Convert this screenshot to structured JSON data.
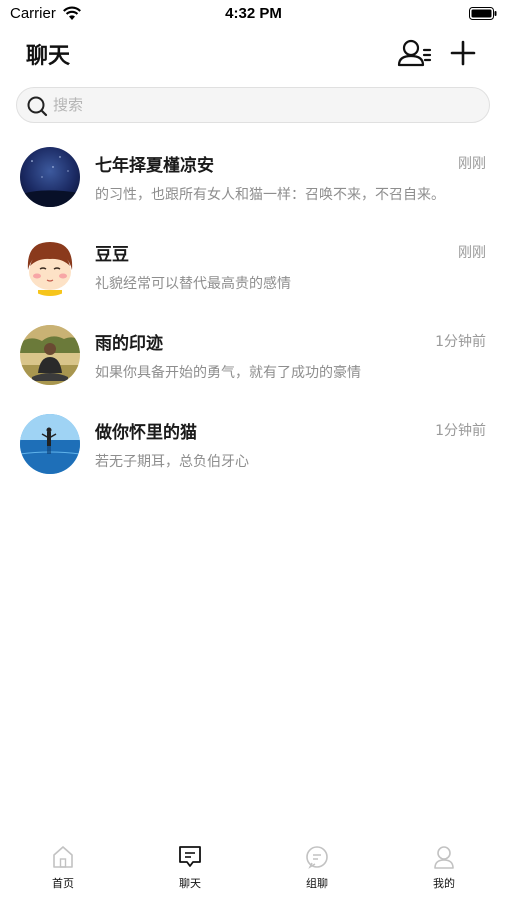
{
  "status_bar": {
    "carrier": "Carrier",
    "time": "4:32 PM"
  },
  "header": {
    "title": "聊天"
  },
  "search": {
    "placeholder": "搜索"
  },
  "chats": [
    {
      "name": "七年择夏槿凉安",
      "time": "刚刚",
      "message": "的习性，也跟所有女人和猫一样：召唤不来，不召自来。",
      "avatar": "night-sky"
    },
    {
      "name": "豆豆",
      "time": "刚刚",
      "message": "礼貌经常可以替代最高贵的感情",
      "avatar": "cartoon-boy"
    },
    {
      "name": "雨的印迹",
      "time": "1分钟前",
      "message": "如果你具备开始的勇气，就有了成功的豪情",
      "avatar": "man-outdoors"
    },
    {
      "name": "做你怀里的猫",
      "time": "1分钟前",
      "message": "若无子期耳，总负伯牙心",
      "avatar": "blue-lake"
    }
  ],
  "tabbar": {
    "tabs": [
      {
        "label": "首页",
        "icon": "home-icon",
        "active": false
      },
      {
        "label": "聊天",
        "icon": "chat-icon",
        "active": true
      },
      {
        "label": "组聊",
        "icon": "group-chat-icon",
        "active": false
      },
      {
        "label": "我的",
        "icon": "profile-icon",
        "active": false
      }
    ]
  },
  "colors": {
    "inactive_icon": "#c2c2c2",
    "active_icon": "#111111",
    "muted_text": "#9a9a9a"
  }
}
